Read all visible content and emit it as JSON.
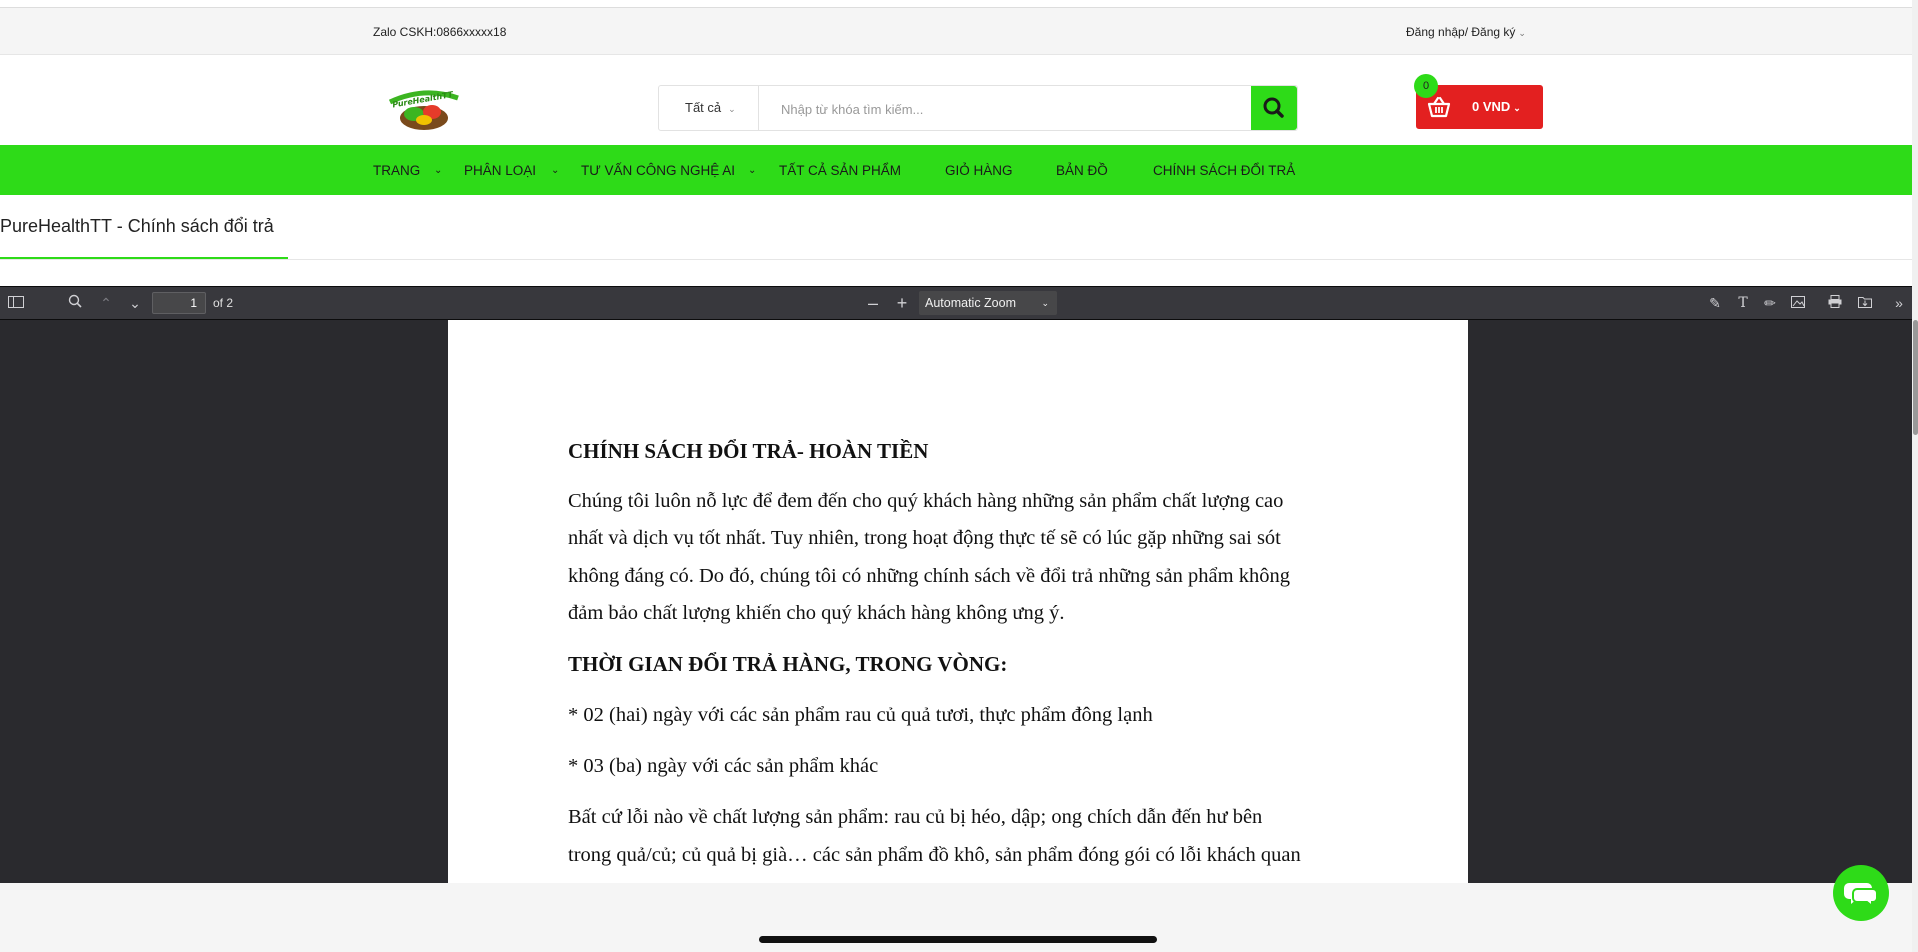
{
  "topbar": {
    "zalo": "Zalo CSKH:0866xxxxx18",
    "login": "Đăng nhập/ Đăng ký"
  },
  "header": {
    "logo_text": "PureHealthTT",
    "search": {
      "category": "Tất cả",
      "placeholder": "Nhập từ khóa tìm kiếm..."
    },
    "cart": {
      "count": "0",
      "amount": "0 VND"
    }
  },
  "nav": {
    "items": [
      {
        "label": "TRANG",
        "has_dropdown": true
      },
      {
        "label": "PHÂN LOẠI",
        "has_dropdown": true
      },
      {
        "label": "TƯ VẤN CÔNG NGHỆ AI",
        "has_dropdown": true
      },
      {
        "label": "TẤT CẢ SẢN PHẨM",
        "has_dropdown": false
      },
      {
        "label": "GIỎ HÀNG",
        "has_dropdown": false
      },
      {
        "label": "BẢN ĐỒ",
        "has_dropdown": false
      },
      {
        "label": "CHÍNH SÁCH ĐỔI TRẢ",
        "has_dropdown": false
      }
    ]
  },
  "page_title": "PureHealthTT - Chính sách đổi trả",
  "pdf_viewer": {
    "page_number": "1",
    "page_count": "of 2",
    "zoom": "Automatic Zoom"
  },
  "pdf_content": {
    "heading1": "CHÍNH SÁCH ĐỔI TRẢ- HOÀN TIỀN",
    "para1_lines": [
      "Chúng tôi luôn nỗ lực để đem đến cho quý khách hàng những sản phẩm chất lượng cao",
      "nhất và dịch vụ tốt nhất. Tuy nhiên, trong hoạt động thực tế sẽ có lúc gặp những sai sót",
      "không đáng có. Do đó, chúng tôi có những chính sách về đổi trả những sản phẩm không",
      "đảm bảo chất lượng khiến cho quý khách hàng không ưng ý."
    ],
    "heading2": "THỜI GIAN ĐỔI TRẢ HÀNG, TRONG VÒNG:",
    "item1": "* 02 (hai) ngày với các sản phẩm rau củ quả tươi, thực phẩm đông lạnh",
    "item2": "* 03 (ba) ngày với các sản phẩm khác",
    "para2_lines": [
      "Bất cứ lỗi nào về chất lượng sản phẩm: rau củ bị héo, dập; ong chích dẫn đến hư bên",
      "trong quả/củ; củ quả bị già… các sản phẩm đồ khô, sản phẩm đóng gói có lỗi khách quan"
    ]
  },
  "colors": {
    "brand_green": "#2edb18",
    "cart_red": "#e32020",
    "pdf_toolbar": "#38383d",
    "pdf_bg": "#2a2a2e"
  }
}
